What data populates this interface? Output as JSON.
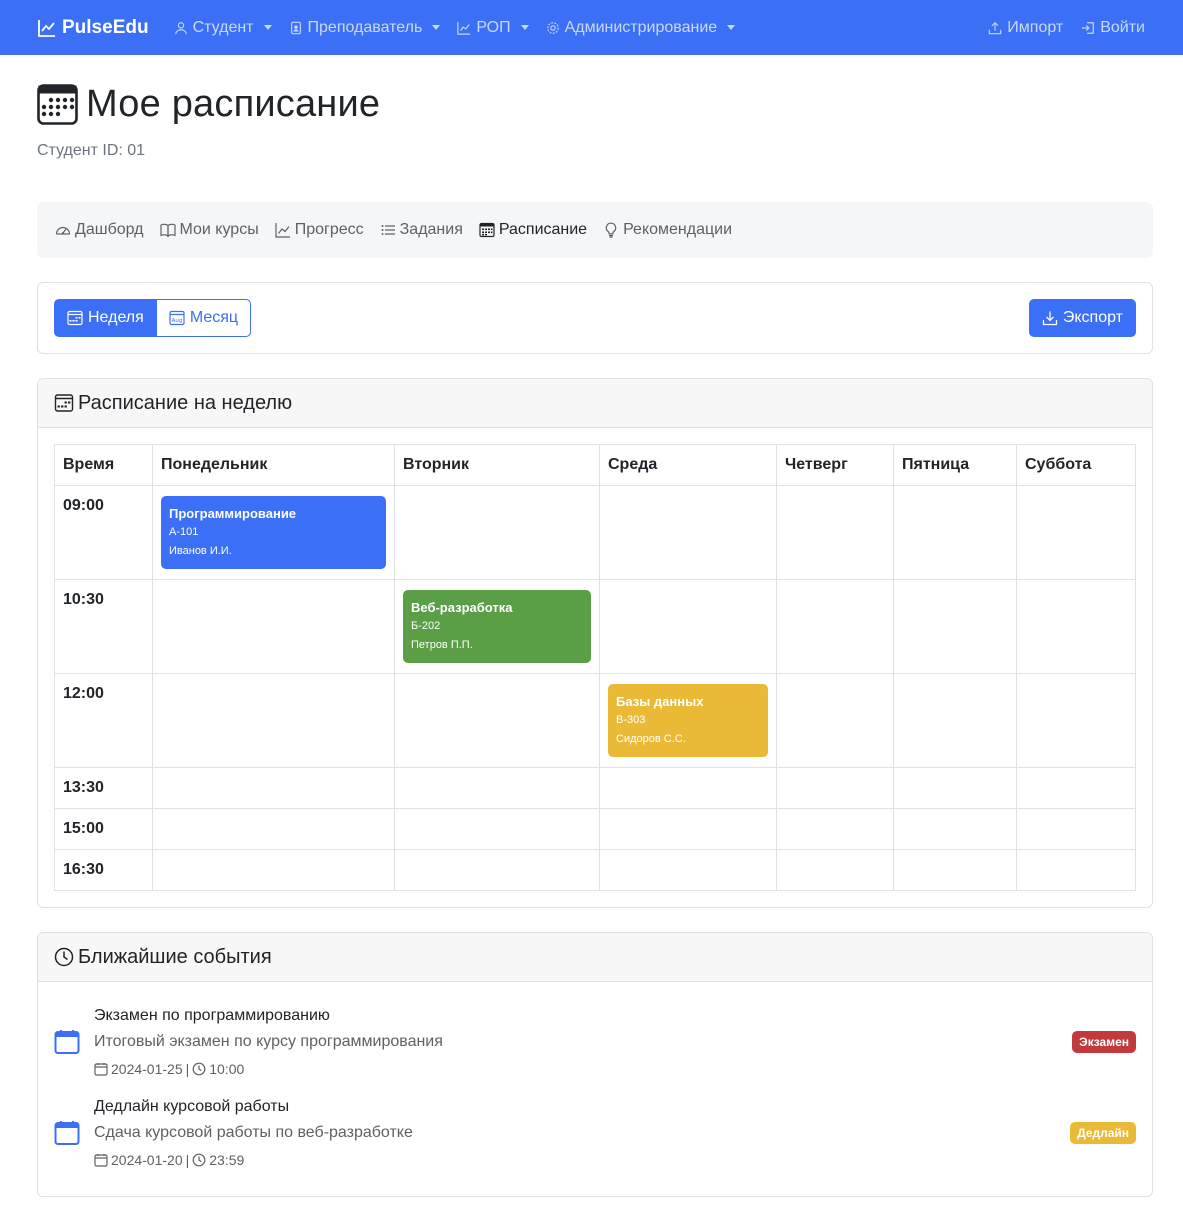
{
  "navbar": {
    "brand": "PulseEdu",
    "items": [
      {
        "label": "Студент"
      },
      {
        "label": "Преподаватель"
      },
      {
        "label": "РОП"
      },
      {
        "label": "Администрирование"
      }
    ],
    "right": [
      {
        "label": "Импорт"
      },
      {
        "label": "Войти"
      }
    ]
  },
  "page": {
    "title": "Мое расписание",
    "subtitle": "Студент ID: 01"
  },
  "subnav": {
    "items": [
      {
        "label": "Дашборд",
        "icon": "speedometer-icon"
      },
      {
        "label": "Мои курсы",
        "icon": "book-icon"
      },
      {
        "label": "Прогресс",
        "icon": "graph-icon"
      },
      {
        "label": "Задания",
        "icon": "list-icon"
      },
      {
        "label": "Расписание",
        "icon": "calendar-grid-icon",
        "active": true
      },
      {
        "label": "Рекомендации",
        "icon": "lightbulb-icon"
      }
    ]
  },
  "toolbar": {
    "week_label": "Неделя",
    "month_label": "Месяц",
    "month_icon_text": "Aug",
    "export_label": "Экспорт"
  },
  "schedule": {
    "title": "Расписание на неделю",
    "headers": [
      "Время",
      "Понедельник",
      "Вторник",
      "Среда",
      "Четверг",
      "Пятница",
      "Суббота"
    ],
    "times": [
      "09:00",
      "10:30",
      "12:00",
      "13:30",
      "15:00",
      "16:30"
    ],
    "events": [
      {
        "title": "Программирование",
        "room": "А-101",
        "teacher": "Иванов И.И."
      },
      {
        "title": "Веб-разработка",
        "room": "Б-202",
        "teacher": "Петров П.П."
      },
      {
        "title": "Базы данных",
        "room": "В-303",
        "teacher": "Сидоров С.С."
      }
    ]
  },
  "upcoming": {
    "title": "Ближайшие события",
    "items": [
      {
        "name": "Экзамен по программированию",
        "desc": "Итоговый экзамен по курсу программирования",
        "date": "2024-01-25",
        "separator": "|",
        "time": "10:00",
        "badge": "Экзамен"
      },
      {
        "name": "Дедлайн курсовой работы",
        "desc": "Сдача курсовой работы по веб-разработке",
        "date": "2024-01-20",
        "separator": "|",
        "time": "23:59",
        "badge": "Дедлайн"
      }
    ]
  },
  "colors": {
    "primary": "#3b6ff5",
    "event_green": "#5a9e46",
    "event_yellow": "#eab935",
    "badge_red": "#c13a3d"
  }
}
